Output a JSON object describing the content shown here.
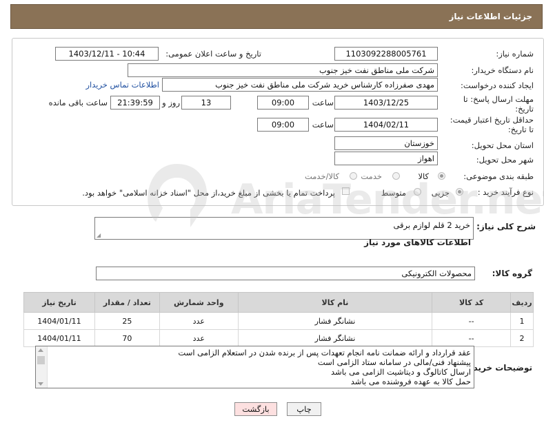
{
  "header": {
    "title": "جزئیات اطلاعات نیاز"
  },
  "form": {
    "need_number_label": "شماره نیاز:",
    "need_number": "1103092288005761",
    "announce_label": "تاریخ و ساعت اعلان عمومی:",
    "announce_value": "1403/12/11 - 10:44",
    "buyer_org_label": "نام دستگاه خریدار:",
    "buyer_org": "شرکت ملی مناطق نفت خیز جنوب",
    "creator_label": "ایجاد کننده درخواست:",
    "creator": "مهدی صفرزاده کارشناس خرید شرکت ملی مناطق نفت خیز جنوب",
    "contact_link": "اطلاعات تماس خریدار",
    "deadline_label": "مهلت ارسال پاسخ: تا تاریخ:",
    "deadline_date": "1403/12/25",
    "time_label": "ساعت",
    "deadline_time": "09:00",
    "days_value": "13",
    "days_label": "روز و",
    "remaining_time": "21:39:59",
    "remaining_label": "ساعت باقی مانده",
    "validity_label": "حداقل تاریخ اعتبار قیمت: تا تاریخ:",
    "validity_date": "1404/02/11",
    "validity_time": "09:00",
    "province_label": "استان محل تحویل:",
    "province": "خوزستان",
    "city_label": "شهر محل تحویل:",
    "city": "اهواز",
    "category_label": "طبقه بندی موضوعی:",
    "category_options": [
      "کالا",
      "خدمت",
      "کالا/خدمت"
    ],
    "category_selected": "کالا",
    "process_label": "نوع فرآیند خرید :",
    "process_options": [
      "جزیی",
      "متوسط"
    ],
    "process_selected": "جزیی",
    "payment_note": "پرداخت تمام یا بخشی از مبلغ خرید،از محل \"اسناد خزانه اسلامی\" خواهد بود."
  },
  "summary": {
    "label": "شرح کلی نیاز:",
    "value": "خرید 2 قلم لوازم برقی"
  },
  "goods": {
    "section_title": "اطلاعات کالاهای مورد نیاز",
    "group_label": "گروه کالا:",
    "group_value": "محصولات الکترونیکی"
  },
  "table": {
    "headers": [
      "ردیف",
      "کد کالا",
      "نام کالا",
      "واحد شمارش",
      "تعداد / مقدار",
      "تاریخ نیاز"
    ],
    "rows": [
      [
        "1",
        "--",
        "نشانگر فشار",
        "عدد",
        "25",
        "1404/01/11"
      ],
      [
        "2",
        "--",
        "نشانگر فشار",
        "عدد",
        "70",
        "1404/01/11"
      ]
    ]
  },
  "notes": {
    "label": "توضیحات خریدار:",
    "lines": [
      "عقد قرارداد و ارائه ضمانت نامه انجام تعهدات پس از برنده شدن در استعلام الزامی است",
      "پیشنهاد فنی/مالی در سامانه ستاد الزامی است",
      "ارسال کاتالوگ و دیتاشیت الزامی می باشد",
      "حمل کالا به عهده فروشنده می باشد"
    ]
  },
  "buttons": {
    "print": "چاپ",
    "back": "بازگشت"
  },
  "watermark": "AriaTender.net",
  "colors": {
    "header_bg": "#8a7256",
    "link": "#1f4fa0",
    "back_bg": "#fde0e0"
  }
}
